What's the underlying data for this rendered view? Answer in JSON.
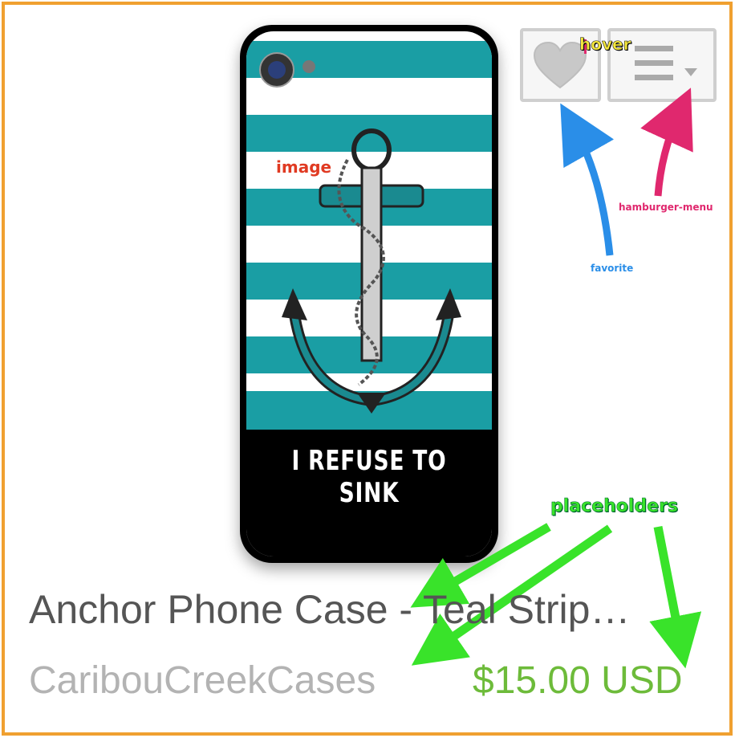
{
  "product": {
    "title": "Anchor Phone Case - Teal Strip…",
    "shop": "CaribouCreekCases",
    "price": "$15.00 USD",
    "image_text": "I REFUSE TO SINK",
    "image_colors": {
      "stripe": "#1a9ea4",
      "band": "#000000"
    }
  },
  "annotations": {
    "hover": "hover",
    "image": "image",
    "hamburger_menu": "hamburger-menu",
    "favorite": "favorite",
    "placeholders": "placeholders"
  },
  "icons": {
    "favorite": "heart-icon",
    "menu": "hamburger-icon",
    "menu_caret": "caret-down-icon"
  },
  "colors": {
    "frame": "#f0a030",
    "title": "#555555",
    "shop": "#b3b3b3",
    "price": "#6dbb3a",
    "arrow_blue": "#2a8ee8",
    "arrow_pink": "#e0286e",
    "arrow_green": "#39e32a"
  }
}
